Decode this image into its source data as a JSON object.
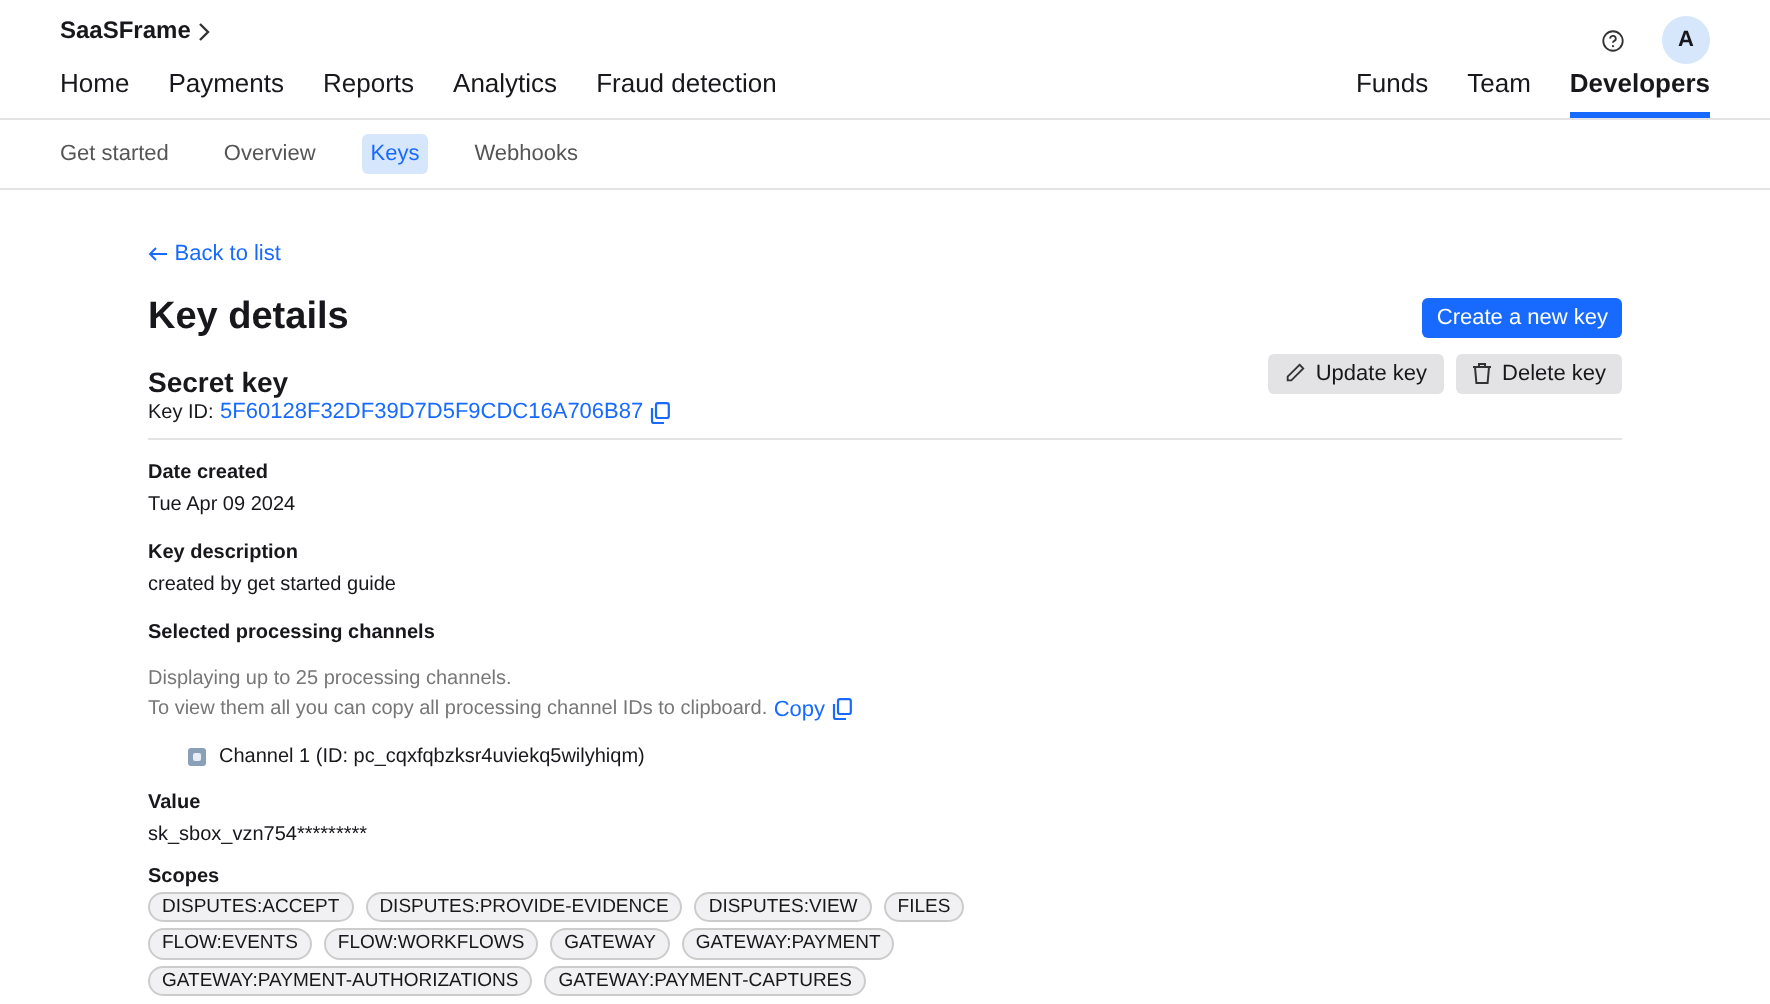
{
  "brand": "SaaSFrame",
  "avatar": "A",
  "main_nav": [
    {
      "label": "Home",
      "selected": false
    },
    {
      "label": "Payments",
      "selected": false
    },
    {
      "label": "Reports",
      "selected": false
    },
    {
      "label": "Analytics",
      "selected": false
    },
    {
      "label": "Fraud detection",
      "selected": false
    }
  ],
  "right_nav": [
    {
      "label": "Funds",
      "selected": false
    },
    {
      "label": "Team",
      "selected": false
    },
    {
      "label": "Developers",
      "selected": true
    }
  ],
  "sub_nav": [
    {
      "label": "Get started",
      "selected": false
    },
    {
      "label": "Overview",
      "selected": false
    },
    {
      "label": "Keys",
      "selected": true
    },
    {
      "label": "Webhooks",
      "selected": false
    }
  ],
  "back_link": "Back to list",
  "title": "Key details",
  "create_button": "Create a new key",
  "key": {
    "name": "Secret key",
    "id_label": "Key ID:",
    "id": "5F60128F32DF39D7D5F9CDC16A706B87"
  },
  "actions": [
    {
      "kind": "update",
      "label": "Update key"
    },
    {
      "kind": "delete",
      "label": "Delete key"
    }
  ],
  "date_created": {
    "label": "Date created",
    "value": "Tue Apr 09 2024"
  },
  "description": {
    "label": "Key description",
    "value": "created by get started guide"
  },
  "channels_section": {
    "label": "Selected processing channels",
    "note": "Displaying up to 25 processing channels.",
    "copy_note": "To view them all you can copy all processing channel IDs to clipboard.",
    "copy_link": "Copy",
    "channels": [
      "Channel 1 (ID: pc_cqxfqbzksr4uviekq5wilyhiqm)"
    ]
  },
  "value": {
    "label": "Value",
    "value": "sk_sbox_vzn754*********"
  },
  "scopes": {
    "label": "Scopes",
    "items": [
      "DISPUTES:ACCEPT",
      "DISPUTES:PROVIDE-EVIDENCE",
      "DISPUTES:VIEW",
      "FILES",
      "FLOW:EVENTS",
      "FLOW:WORKFLOWS",
      "GATEWAY",
      "GATEWAY:PAYMENT",
      "GATEWAY:PAYMENT-AUTHORIZATIONS",
      "GATEWAY:PAYMENT-CAPTURES"
    ]
  }
}
